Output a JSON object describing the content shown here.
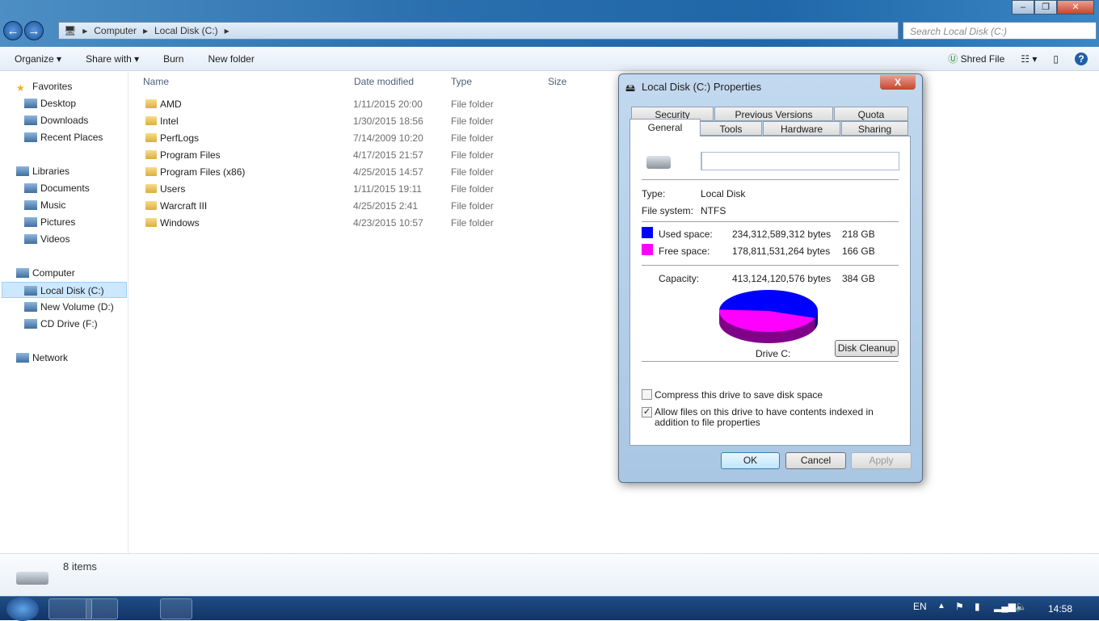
{
  "window": {
    "minimize": "‒",
    "maximize": "❐",
    "close": "✕"
  },
  "address": {
    "crumbs": [
      "Computer",
      "Local Disk (C:)"
    ],
    "search_placeholder": "Search Local Disk (C:)"
  },
  "toolbar": {
    "organize": "Organize ▾",
    "share": "Share with ▾",
    "burn": "Burn",
    "new_folder": "New folder",
    "shred": "Shred File"
  },
  "sidebar": [
    {
      "label": "Favorites",
      "group": true
    },
    {
      "label": "Desktop"
    },
    {
      "label": "Downloads"
    },
    {
      "label": "Recent Places"
    },
    {
      "label": "Libraries",
      "group": true
    },
    {
      "label": "Documents"
    },
    {
      "label": "Music"
    },
    {
      "label": "Pictures"
    },
    {
      "label": "Videos"
    },
    {
      "label": "Computer",
      "group": true
    },
    {
      "label": "Local Disk (C:)",
      "selected": true
    },
    {
      "label": "New Volume (D:)"
    },
    {
      "label": "CD Drive (F:)"
    },
    {
      "label": "Network",
      "group": true
    }
  ],
  "columns": [
    "Name",
    "Date modified",
    "Type",
    "Size"
  ],
  "files": [
    {
      "name": "AMD",
      "date": "1/11/2015 20:00",
      "type": "File folder"
    },
    {
      "name": "Intel",
      "date": "1/30/2015 18:56",
      "type": "File folder"
    },
    {
      "name": "PerfLogs",
      "date": "7/14/2009 10:20",
      "type": "File folder"
    },
    {
      "name": "Program Files",
      "date": "4/17/2015 21:57",
      "type": "File folder"
    },
    {
      "name": "Program Files (x86)",
      "date": "4/25/2015 14:57",
      "type": "File folder"
    },
    {
      "name": "Users",
      "date": "1/11/2015 19:11",
      "type": "File folder"
    },
    {
      "name": "Warcraft III",
      "date": "4/25/2015 2:41",
      "type": "File folder"
    },
    {
      "name": "Windows",
      "date": "4/23/2015 10:57",
      "type": "File folder"
    }
  ],
  "status": {
    "count": "8 items"
  },
  "dialog": {
    "title": "Local Disk (C:) Properties",
    "close": "X",
    "tabs_back": [
      "Security",
      "Previous Versions",
      "Quota"
    ],
    "tabs_front": [
      "General",
      "Tools",
      "Hardware",
      "Sharing"
    ],
    "name_value": "",
    "type_label": "Type:",
    "type_value": "Local Disk",
    "fs_label": "File system:",
    "fs_value": "NTFS",
    "used_label": "Used space:",
    "used_bytes": "234,312,589,312 bytes",
    "used_gb": "218 GB",
    "free_label": "Free space:",
    "free_bytes": "178,811,531,264 bytes",
    "free_gb": "166 GB",
    "cap_label": "Capacity:",
    "cap_bytes": "413,124,120,576 bytes",
    "cap_gb": "384 GB",
    "drive_label": "Drive C:",
    "cleanup": "Disk Cleanup",
    "compress": "Compress this drive to save disk space",
    "compress_checked": false,
    "index": "Allow files on this drive to have contents indexed in addition to file properties",
    "index_checked": true,
    "ok": "OK",
    "cancel": "Cancel",
    "apply": "Apply",
    "used_color": "#0000ff",
    "free_color": "#ff00ff",
    "used_fraction": 0.567
  },
  "tray": {
    "lang": "EN",
    "time": "14:58"
  }
}
